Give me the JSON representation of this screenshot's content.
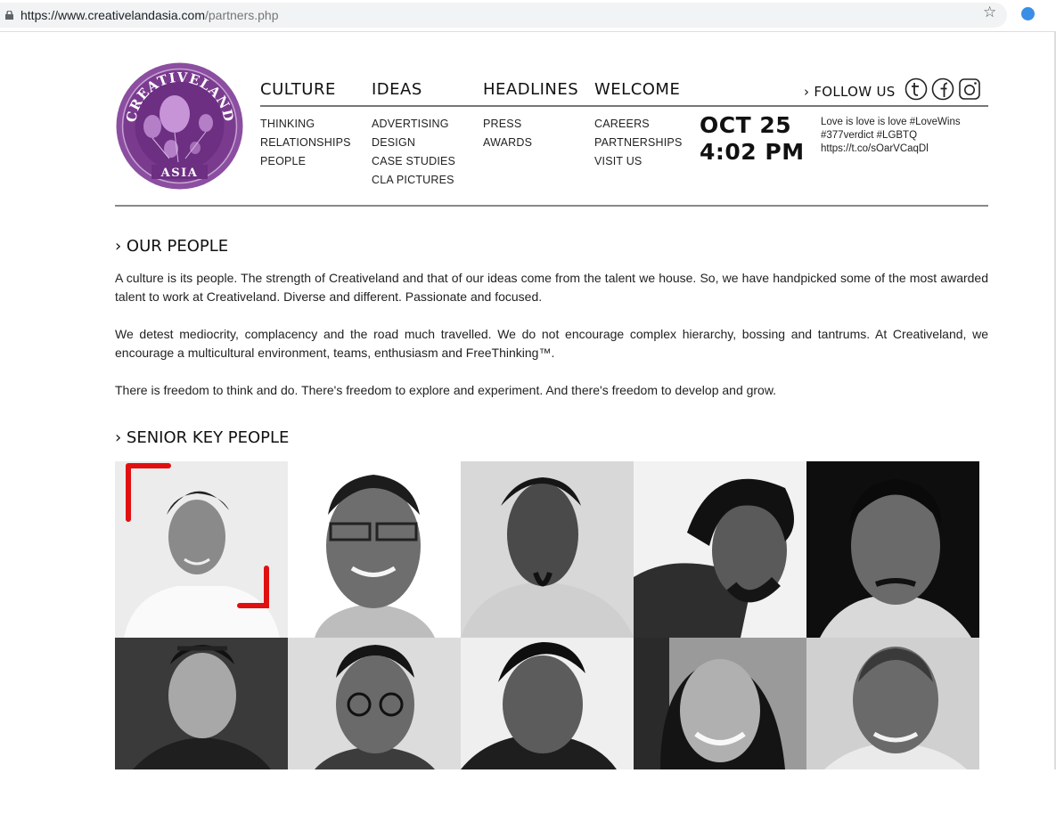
{
  "browser": {
    "url_host": "https://www.creativelandasia.com",
    "url_path": "/partners.php"
  },
  "logo": {
    "top_text": "CREATIVELAND",
    "bottom_text": "ASIA"
  },
  "nav": [
    {
      "heading": "CULTURE",
      "items": [
        "THINKING",
        "RELATIONSHIPS",
        "PEOPLE"
      ]
    },
    {
      "heading": "IDEAS",
      "items": [
        "ADVERTISING",
        "DESIGN",
        "CASE STUDIES",
        "CLA PICTURES"
      ]
    },
    {
      "heading": "HEADLINES",
      "items": [
        "PRESS",
        "AWARDS"
      ]
    },
    {
      "heading": "WELCOME",
      "items": [
        "CAREERS",
        "PARTNERSHIPS",
        "VISIT US"
      ]
    }
  ],
  "datetime": {
    "date": "OCT 25",
    "time": "4:02 PM"
  },
  "follow": {
    "label": "› FOLLOW US",
    "icons": [
      "twitter-icon",
      "facebook-icon",
      "instagram-icon"
    ]
  },
  "tweet": {
    "line1": "Love is love is love #LoveWins",
    "line2": "#377verdict #LGBTQ",
    "line3": "https://t.co/sOarVCaqDl"
  },
  "our_people": {
    "title": "› OUR PEOPLE",
    "paragraphs": [
      "A culture is its people. The strength of Creativeland and that of our ideas come from the talent we house. So, we have handpicked some of the most awarded talent to work at Creativeland. Diverse and different. Passionate and focused.",
      "We detest mediocrity, complacency and the road much travelled. We do not encourage complex hierarchy, bossing and tantrums. At Creativeland, we encourage a multicultural environment, teams, enthusiasm and FreeThinking™.",
      "There is freedom to think and do. There's freedom to explore and experiment. And there's freedom to develop and grow."
    ]
  },
  "senior": {
    "title": "› SENIOR KEY PEOPLE",
    "photo_count": 10
  },
  "colors": {
    "logo_purple": "#7a3b8f",
    "logo_light": "#b57fc7",
    "highlight_red": "#e01010"
  }
}
